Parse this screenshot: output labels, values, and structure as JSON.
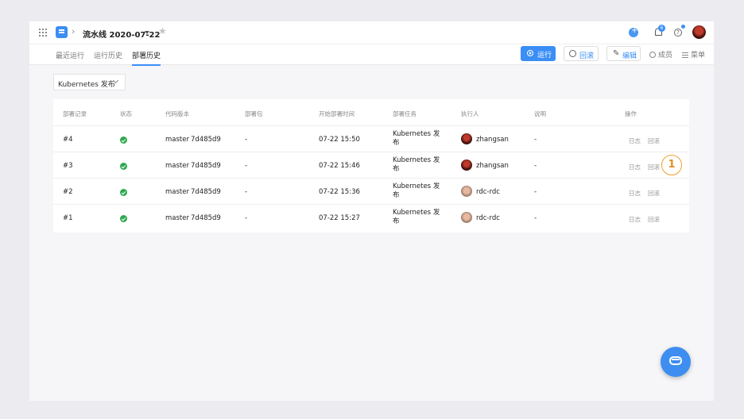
{
  "header": {
    "pipeline_title": "流水线 2020-07-22",
    "notification_count": "6",
    "help_glyph": "?"
  },
  "tabs": [
    {
      "label": "最近运行",
      "active": false
    },
    {
      "label": "运行历史",
      "active": false
    },
    {
      "label": "部署历史",
      "active": true
    }
  ],
  "toolbar": {
    "run_label": "运行",
    "rollback_label": "回滚",
    "edit_label": "编辑",
    "members_label": "成员",
    "menu_label": "菜单"
  },
  "env_select": {
    "value": "Kubernetes 发布"
  },
  "table": {
    "columns": [
      "部署记录",
      "状态",
      "代码版本",
      "部署包",
      "开始部署时间",
      "部署任务",
      "执行人",
      "说明",
      "操作"
    ],
    "rows": [
      {
        "record": "#4",
        "status": "success",
        "branch": "master",
        "commit": "7d485d9",
        "package": "-",
        "start_time": "07-22 15:50",
        "task": "Kubernetes 发布",
        "executor": "zhangsan",
        "avatar": "dark",
        "note": "-",
        "op_log": "日志",
        "op_rollback": "回滚"
      },
      {
        "record": "#3",
        "status": "success",
        "branch": "master",
        "commit": "7d485d9",
        "package": "-",
        "start_time": "07-22 15:46",
        "task": "Kubernetes 发布",
        "executor": "zhangsan",
        "avatar": "dark",
        "note": "-",
        "op_log": "日志",
        "op_rollback": "回滚"
      },
      {
        "record": "#2",
        "status": "success",
        "branch": "master",
        "commit": "7d485d9",
        "package": "-",
        "start_time": "07-22 15:36",
        "task": "Kubernetes 发布",
        "executor": "rdc-rdc",
        "avatar": "light",
        "note": "-",
        "op_log": "日志",
        "op_rollback": "回滚"
      },
      {
        "record": "#1",
        "status": "success",
        "branch": "master",
        "commit": "7d485d9",
        "package": "-",
        "start_time": "07-22 15:27",
        "task": "Kubernetes 发布",
        "executor": "rdc-rdc",
        "avatar": "light",
        "note": "-",
        "op_log": "日志",
        "op_rollback": "回滚"
      }
    ]
  },
  "annotation": {
    "marker_label": "1"
  },
  "colors": {
    "accent": "#3a8ef5",
    "success": "#2fa84f",
    "marker": "#f0a030"
  }
}
